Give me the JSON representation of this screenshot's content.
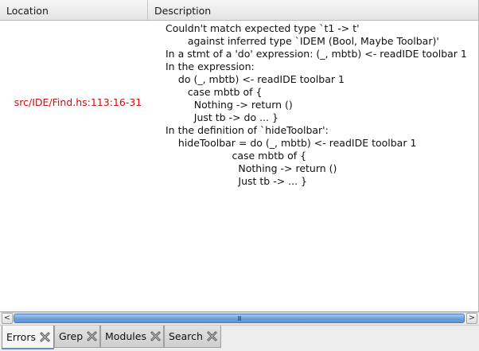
{
  "table": {
    "columns": [
      "Location",
      "Description"
    ],
    "rows": [
      {
        "location": "src/IDE/Find.hs:113:16-31",
        "description": [
          "Couldn't match expected type `t1 -> t'",
          "       against inferred type `IDEM (Bool, Maybe Toolbar)'",
          "In a stmt of a 'do' expression: (_, mbtb) <- readIDE toolbar 1",
          "In the expression:",
          "    do (_, mbtb) <- readIDE toolbar 1",
          "       case mbtb of {",
          "         Nothing -> return ()",
          "         Just tb -> do ... }",
          "In the definition of `hideToolbar':",
          "    hideToolbar = do (_, mbtb) <- readIDE toolbar 1",
          "                     case mbtb of {",
          "                       Nothing -> return ()",
          "                       Just tb -> ... }"
        ]
      }
    ]
  },
  "scrollbar": {
    "left_arrow": "<",
    "right_arrow": ">",
    "grip": "III"
  },
  "tabs": [
    {
      "label": "Errors",
      "active": true
    },
    {
      "label": "Grep",
      "active": false
    },
    {
      "label": "Modules",
      "active": false
    },
    {
      "label": "Search",
      "active": false
    }
  ],
  "icons": {
    "tab_close": "close-icon"
  },
  "colors": {
    "location_text": "#cc1010",
    "scroll_thumb": "#6c9fd8"
  }
}
